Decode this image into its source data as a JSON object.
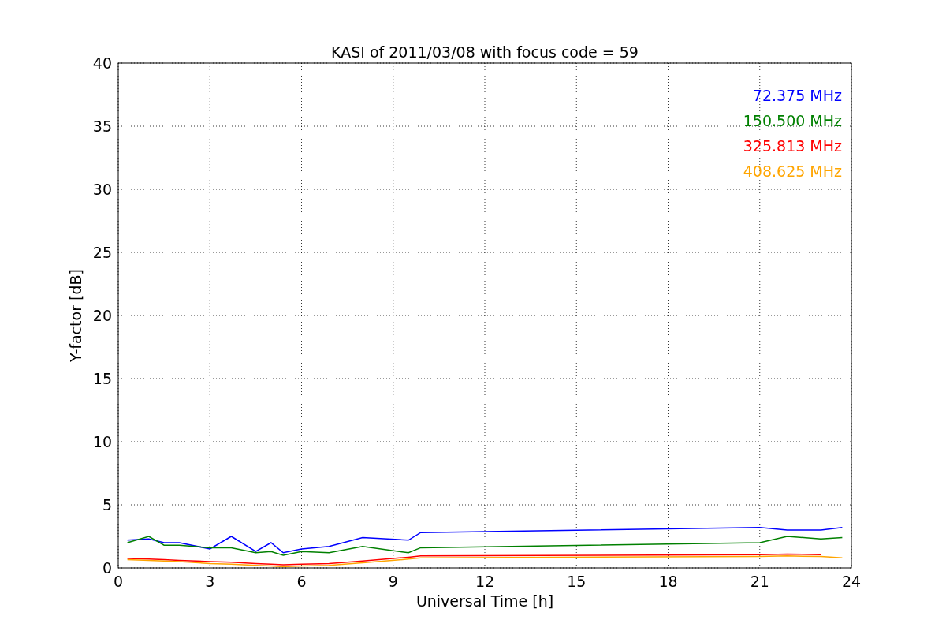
{
  "figure": {
    "chart_data": {
      "type": "line",
      "title": "KASI of 2011/03/08 with focus code = 59",
      "xlabel": "Universal Time [h]",
      "ylabel": "Y-factor [dB]",
      "x": [
        0.3,
        1.0,
        1.5,
        2.0,
        3.0,
        3.7,
        4.5,
        5.0,
        5.4,
        6.0,
        6.9,
        8.0,
        9.5,
        9.9,
        21.0,
        21.9,
        23.0,
        23.7
      ],
      "series": [
        {
          "name": "72.375 MHz",
          "color": "#0000ff",
          "values": [
            2.2,
            2.3,
            2.0,
            2.0,
            1.5,
            2.5,
            1.3,
            2.0,
            1.2,
            1.5,
            1.7,
            2.4,
            2.2,
            2.8,
            3.2,
            3.0,
            3.0,
            3.2
          ]
        },
        {
          "name": "150.500 MHz",
          "color": "#008000",
          "values": [
            2.0,
            2.5,
            1.8,
            1.8,
            1.6,
            1.6,
            1.2,
            1.3,
            1.0,
            1.3,
            1.2,
            1.7,
            1.2,
            1.6,
            2.0,
            2.5,
            2.3,
            2.4
          ]
        },
        {
          "name": "325.813 MHz",
          "color": "#ff0000",
          "values": [
            0.75,
            0.7,
            0.65,
            0.6,
            0.5,
            0.45,
            0.35,
            0.3,
            0.25,
            0.3,
            0.35,
            0.55,
            0.85,
            0.95,
            1.05,
            1.1,
            1.05,
            null
          ]
        },
        {
          "name": "408.625 MHz",
          "color": "#ffa500",
          "values": [
            0.65,
            0.6,
            0.55,
            0.5,
            0.35,
            0.3,
            0.2,
            0.15,
            0.1,
            0.15,
            0.2,
            0.4,
            0.7,
            0.8,
            0.9,
            0.95,
            0.9,
            0.8
          ]
        }
      ],
      "xlim": [
        0,
        24
      ],
      "grid": true,
      "ylim": [
        0,
        40
      ],
      "xticks": [
        0,
        3,
        6,
        9,
        12,
        15,
        18,
        21,
        24
      ],
      "yticks": [
        0,
        5,
        10,
        15,
        20,
        25,
        30,
        35,
        40
      ]
    }
  }
}
